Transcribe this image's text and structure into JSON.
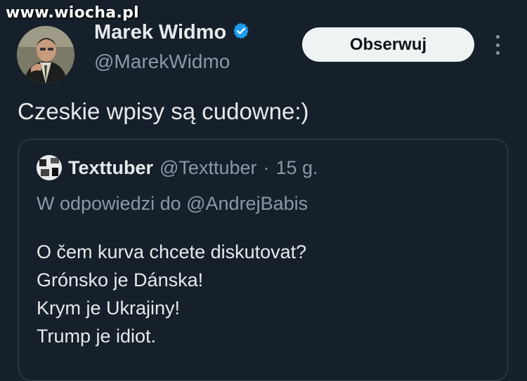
{
  "watermark": "www.wiocha.pl",
  "author": {
    "display_name": "Marek Widmo",
    "handle": "@MarekWidmo",
    "verified_icon": "verified-badge-icon"
  },
  "follow_label": "Obserwuj",
  "tweet_text": "Czeskie wpisy są cudowne:)",
  "quote": {
    "display_name": "Texttuber",
    "handle": "@Texttuber",
    "separator": "·",
    "time": "15 g.",
    "reply_to": "W odpowiedzi do @AndrejBabis",
    "lines": [
      "O čem kurva chcete diskutovat?",
      "Grónsko je Dánska!",
      "Krym je Ukrajiny!",
      "Trump je idiot."
    ]
  },
  "colors": {
    "background": "#15202b",
    "verified": "#1d9bf0",
    "follow_bg": "#eff3f4",
    "secondary_text": "#8b98a5"
  }
}
